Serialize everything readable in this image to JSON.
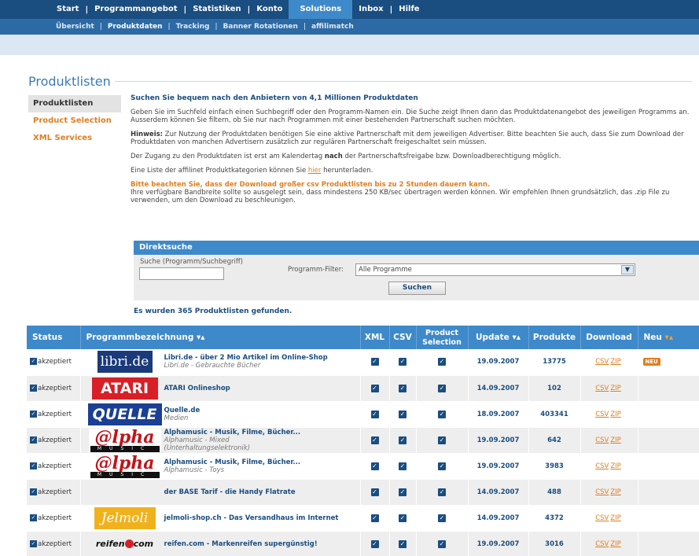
{
  "topnav": {
    "items": [
      "Start",
      "Programmangebot",
      "Statistiken",
      "Konto",
      "Solutions",
      "Inbox",
      "Hilfe"
    ],
    "active": "Solutions"
  },
  "subnav": {
    "items": [
      "Übersicht",
      "Produktdaten",
      "Tracking",
      "Banner Rotationen",
      "affilimatch"
    ],
    "active": "Produktdaten"
  },
  "page_title": "Produktlisten",
  "sidebar": {
    "items": [
      {
        "label": "Produktlisten",
        "active": true
      },
      {
        "label": "Product Selection",
        "active": false
      },
      {
        "label": "XML Services",
        "active": false
      }
    ]
  },
  "intro": {
    "headline": "Suchen Sie bequem nach den Anbietern von 4,1 Millionen Produktdaten",
    "p1": "Geben Sie im Suchfeld einfach einen Suchbegriff oder den Programm-Namen ein. Die Suche zeigt Ihnen dann das Produktdatenangebot des jeweiligen Programms an. Ausserdem können Sie filtern, ob Sie nur nach Programmen mit einer bestehenden Partnerschaft suchen möchten.",
    "hint_label": "Hinweis:",
    "hint_text": " Zur Nutzung der Produktdaten benötigen Sie eine aktive Partnerschaft mit dem jeweiligen Advertiser. Bitte beachten Sie auch, dass Sie zum Download der Produktdaten von manchen Advertisern zusätzlich zur regulären Partnerschaft freigeschaltet sein müssen.",
    "access_pre": "Der Zugang zu den Produktdaten ist erst am Kalendertag ",
    "access_bold": "nach",
    "access_post": " der Partnerschaftsfreigabe bzw. Downloadberechtigung möglich.",
    "list_pre": "Eine Liste der affilinet Produktkategorien können Sie ",
    "list_link": "hier",
    "list_post": " herunterladen.",
    "warning": "Bitte beachten Sie, dass der Download großer csv Produktlisten bis zu 2 Stunden dauern kann.",
    "warning_text": "Ihre verfügbare Bandbreite sollte so ausgelegt sein, dass mindestens 250 KB/sec übertragen werden können. Wir empfehlen Ihnen grundsätzlich, das .zip File zu verwenden, um den Download zu beschleunigen."
  },
  "direktsuche": {
    "title": "Direktsuche",
    "search_label": "Suche (Programm/Suchbegriff)",
    "search_value": "",
    "filter_label": "Programm-Filter:",
    "filter_value": "Alle Programme",
    "button": "Suchen"
  },
  "results_text": "Es wurden 365 Produktlisten gefunden.",
  "table": {
    "headers": {
      "status": "Status",
      "name": "Programmbezeichnung",
      "xml": "XML",
      "csv": "CSV",
      "ps_line1": "Product",
      "ps_line2": "Selection",
      "update": "Update",
      "produkte": "Produkte",
      "download": "Download",
      "neu": "Neu"
    },
    "status_label": "akzeptiert",
    "csv_link": "CSV",
    "zip_link": "ZIP",
    "neu_badge": "NEU",
    "rows": [
      {
        "logo": "libri.de",
        "logo_style": "libri",
        "name": "Libri.de - über 2 Mio Artikel im Online-Shop",
        "sub1": "Libri.de - Gebrauchte Bücher",
        "sub2": "",
        "date": "19.09.2007",
        "count": "13775",
        "neu": true
      },
      {
        "logo": "ATARI",
        "logo_style": "atari",
        "name": "ATARI Onlineshop",
        "sub1": "",
        "sub2": "",
        "date": "14.09.2007",
        "count": "102",
        "neu": false
      },
      {
        "logo": "QUELLE",
        "logo_style": "quelle",
        "name": "Quelle.de",
        "sub1": "Medien",
        "sub2": "",
        "date": "18.09.2007",
        "count": "403341",
        "neu": false
      },
      {
        "logo": "@lpha",
        "logo_style": "alpha",
        "logo_sub": "MUSIC",
        "name": "Alphamusic - Musik, Filme, Bücher...",
        "sub1": "Alphamusic - Mixed",
        "sub2": "(Unterhaltungselektronik)",
        "date": "19.09.2007",
        "count": "642",
        "neu": false
      },
      {
        "logo": "@lpha",
        "logo_style": "alpha",
        "logo_sub": "MUSIC",
        "name": "Alphamusic - Musik, Filme, Bücher...",
        "sub1": "Alphamusic - Toys",
        "sub2": "",
        "date": "19.09.2007",
        "count": "3983",
        "neu": false
      },
      {
        "logo": "",
        "logo_style": "none",
        "name": "der BASE Tarif - die Handy Flatrate",
        "sub1": "",
        "sub2": "",
        "date": "14.09.2007",
        "count": "488",
        "neu": false
      },
      {
        "logo": "Jelmoli",
        "logo_style": "jelmoli",
        "name": "jelmoli-shop.ch - Das Versandhaus im Internet",
        "sub1": "",
        "sub2": "",
        "date": "14.09.2007",
        "count": "4372",
        "neu": false
      },
      {
        "logo": "reifen com",
        "logo_style": "reifen",
        "logo_a": "reifen",
        "logo_b": "com",
        "name": "reifen.com - Markenreifen supergünstig!",
        "sub1": "",
        "sub2": "",
        "date": "19.09.2007",
        "count": "3016",
        "neu": false
      }
    ]
  },
  "colors": {
    "nav_dark": "#1a4d80",
    "nav_active": "#3e89c9",
    "accent_orange": "#e07e1f"
  }
}
